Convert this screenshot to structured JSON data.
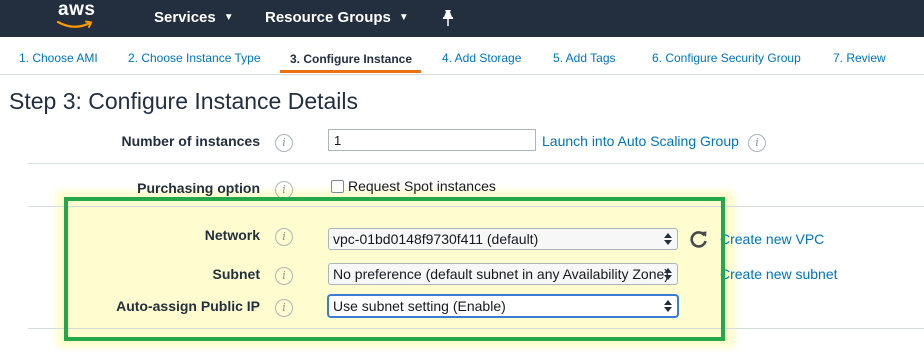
{
  "header": {
    "logo": "aws",
    "services_label": "Services",
    "resource_groups_label": "Resource Groups",
    "colors": {
      "background": "#232f3e",
      "logo_smile": "#ff9900"
    }
  },
  "wizard": {
    "steps": [
      {
        "label": "1. Choose AMI"
      },
      {
        "label": "2. Choose Instance Type"
      },
      {
        "label": "3. Configure Instance",
        "active": true
      },
      {
        "label": "4. Add Storage"
      },
      {
        "label": "5. Add Tags"
      },
      {
        "label": "6. Configure Security Group"
      },
      {
        "label": "7. Review"
      }
    ],
    "active_color": "#ec7211"
  },
  "page": {
    "title": "Step 3: Configure Instance Details"
  },
  "form": {
    "instances": {
      "label": "Number of instances",
      "value": "1",
      "link": "Launch into Auto Scaling Group"
    },
    "purchasing": {
      "label": "Purchasing option",
      "checkbox_label": "Request Spot instances",
      "checked": false
    },
    "network": {
      "label": "Network",
      "value": "vpc-01bd0148f9730f411 (default)",
      "link": "Create new VPC"
    },
    "subnet": {
      "label": "Subnet",
      "value": "No preference (default subnet in any Availability Zone)",
      "link": "Create new subnet"
    },
    "public_ip": {
      "label": "Auto-assign Public IP",
      "value": "Use subnet setting (Enable)"
    }
  },
  "highlight_color": "#25a84a"
}
